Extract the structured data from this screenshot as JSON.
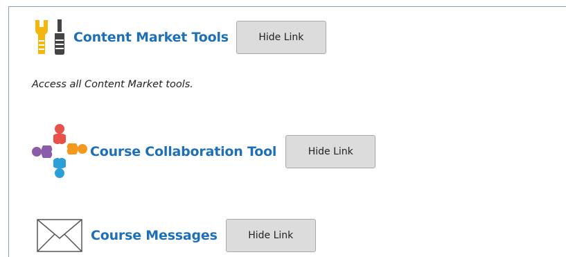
{
  "tools": [
    {
      "title": "Content Market Tools",
      "description": "Access all Content Market tools.",
      "button_label": "Hide Link",
      "icon": "wrench-screwdriver-icon"
    },
    {
      "title": "Course Collaboration Tool",
      "button_label": "Hide Link",
      "icon": "people-collaboration-icon"
    },
    {
      "title": "Course Messages",
      "button_label": "Hide Link",
      "icon": "envelope-icon"
    }
  ],
  "colors": {
    "link": "#1d70b8",
    "button_bg": "#dcdcdc",
    "panel_border": "#8a9fb8",
    "icon_yellow": "#f5b50f",
    "icon_dark": "#444444",
    "collab_red": "#e8504a",
    "collab_orange": "#f39a1e",
    "collab_blue": "#2c9fd9",
    "collab_purple": "#8b5ca9"
  }
}
